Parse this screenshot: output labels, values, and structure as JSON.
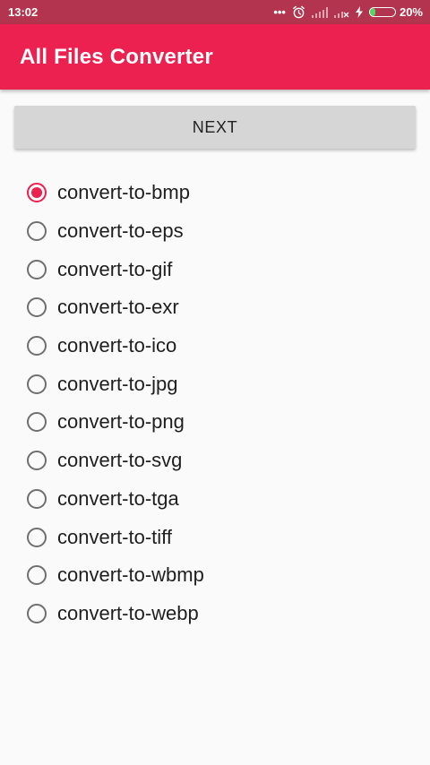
{
  "status_bar": {
    "time": "13:02",
    "more_indicator": "•••",
    "icons": [
      "alarm-icon",
      "signal-icon",
      "signal-no-service-icon",
      "charging-icon",
      "battery-icon"
    ],
    "battery_percent": "20%",
    "battery_level": 0.2,
    "battery_color": "#4cd964"
  },
  "app_bar": {
    "title": "All Files Converter",
    "color": "#ec2150"
  },
  "next_button": {
    "label": "NEXT"
  },
  "options": [
    {
      "label": "convert-to-bmp",
      "checked": true
    },
    {
      "label": "convert-to-eps",
      "checked": false
    },
    {
      "label": "convert-to-gif",
      "checked": false
    },
    {
      "label": "convert-to-exr",
      "checked": false
    },
    {
      "label": "convert-to-ico",
      "checked": false
    },
    {
      "label": "convert-to-jpg",
      "checked": false
    },
    {
      "label": "convert-to-png",
      "checked": false
    },
    {
      "label": "convert-to-svg",
      "checked": false
    },
    {
      "label": "convert-to-tga",
      "checked": false
    },
    {
      "label": "convert-to-tiff",
      "checked": false
    },
    {
      "label": "convert-to-wbmp",
      "checked": false
    },
    {
      "label": "convert-to-webp",
      "checked": false
    }
  ],
  "colors": {
    "accent": "#ec2150",
    "status_bar": "#b3344e",
    "button": "#d6d6d6",
    "background": "#fafafa"
  }
}
